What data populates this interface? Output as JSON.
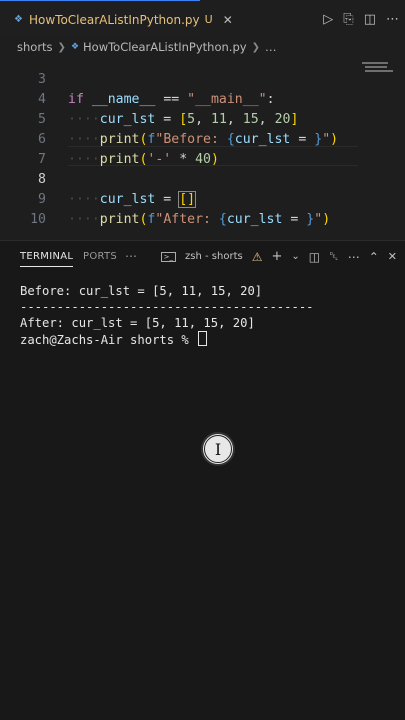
{
  "tab": {
    "title": "HowToClearAListInPython.py",
    "modified": "U",
    "icon": "python-icon"
  },
  "actions": {
    "run": "▷",
    "compare": "⎘",
    "split": "◫",
    "more": "⋯"
  },
  "breadcrumb": {
    "folder": "shorts",
    "file": "HowToClearAListInPython.py",
    "more": "…"
  },
  "editor": {
    "lines": [
      {
        "num": "3",
        "indent": "",
        "code": "if __name__ == \"__main__\":"
      },
      {
        "num": "4",
        "indent": "····",
        "code": "cur_lst = [5, 11, 15, 20]"
      },
      {
        "num": "5",
        "indent": "····",
        "code": "print(f\"Before: {cur_lst = }\")"
      },
      {
        "num": "6",
        "indent": "····",
        "code": "print('-' * 40)"
      },
      {
        "num": "7",
        "indent": "",
        "code": ""
      },
      {
        "num": "8",
        "indent": "····",
        "code": "cur_lst = []"
      },
      {
        "num": "9",
        "indent": "····",
        "code": "print(f\"After: {cur_lst = }\")"
      },
      {
        "num": "10",
        "indent": "",
        "code": ""
      }
    ],
    "active_line": "8"
  },
  "panel": {
    "tabs": [
      "TERMINAL",
      "PORTS",
      "⋯"
    ],
    "shell_label": "zsh - shorts",
    "tools": {
      "add": "+",
      "chevron": "⌄",
      "split": "◫",
      "trash": "␡",
      "more": "⋯",
      "maximize": "⌃",
      "close": "✕"
    }
  },
  "terminal": {
    "lines": [
      "Before: cur_lst = [5, 11, 15, 20]",
      "----------------------------------------",
      "After: cur_lst = [5, 11, 15, 20]",
      "zach@Zachs-Air shorts % "
    ]
  },
  "pointer": {
    "glyph": "I"
  },
  "colors": {
    "accent": "#3b82f6",
    "editor_bg": "#1e1e1e",
    "panel_bg": "#181818",
    "tab_title": "#e5c07b"
  }
}
